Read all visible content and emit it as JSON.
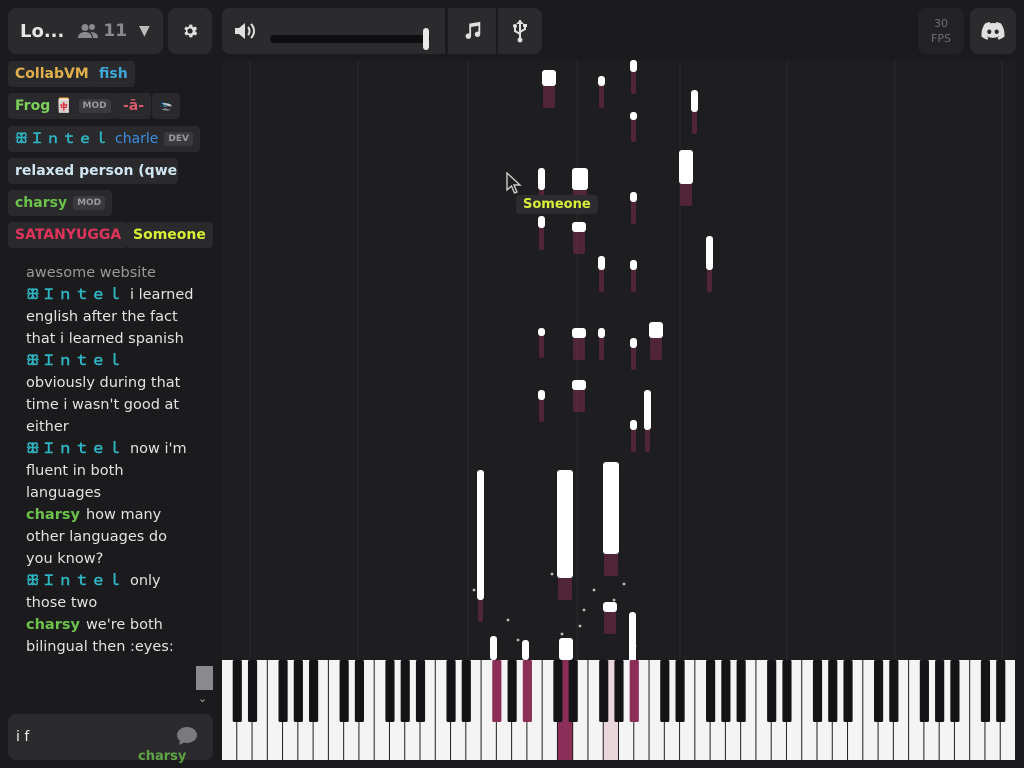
{
  "room": {
    "name": "Lo...",
    "user_count": "11"
  },
  "toolbar": {
    "volume_level": 0.96
  },
  "fps": {
    "value": "30",
    "label": "FPS"
  },
  "users": [
    {
      "name": "CollabVM",
      "color": "#e0b04a",
      "badge": ""
    },
    {
      "name": "fish",
      "color": "#3fa8d8",
      "badge": ""
    },
    {
      "name": "Frog 🀄",
      "color": "#7fd05a",
      "badge": "MOD"
    },
    {
      "name": "-ā-",
      "color": "#d85a6a",
      "badge": ""
    },
    {
      "name": "🛬",
      "color": "#dddddd",
      "badge": ""
    },
    {
      "name": "ꕥＩｎｔｅｌ",
      "color": "#2fb6c4",
      "badge": ""
    },
    {
      "name": "charle",
      "color": "#3a8ee6",
      "badge": "DEV"
    },
    {
      "name": "relaxed person (qwer...",
      "color": "#cfe6f2",
      "badge": ""
    },
    {
      "name": "charsy",
      "color": "#6cc24a",
      "badge": "MOD"
    },
    {
      "name": "SATANYUGGA",
      "color": "#e0335c",
      "badge": ""
    },
    {
      "name": "Someone",
      "color": "#d8ef34",
      "badge": ""
    }
  ],
  "chat": {
    "first_line": "awesome website",
    "messages": [
      {
        "user": "ꕥＩｎｔｅｌ",
        "color": "#2fb6c4",
        "text": "i learned english after the fact that i learned spanish"
      },
      {
        "user": "ꕥＩｎｔｅｌ",
        "color": "#2fb6c4",
        "text": "obviously during that time i wasn't good at either"
      },
      {
        "user": "ꕥＩｎｔｅｌ",
        "color": "#2fb6c4",
        "text": "now i'm fluent in both languages"
      },
      {
        "user": "charsy",
        "color": "#6cc24a",
        "text": "how many other languages do you know?"
      },
      {
        "user": "ꕥＩｎｔｅｌ",
        "color": "#2fb6c4",
        "text": "only those two"
      },
      {
        "user": "charsy",
        "color": "#6cc24a",
        "text": "we're both bilingual then :eyes:"
      }
    ],
    "input_value": "i f",
    "overlay_user": "charsy"
  },
  "cursors": [
    {
      "name": "Someone",
      "color": "#d8ef34"
    }
  ],
  "colors": {
    "note": "#ffffff",
    "active_key": "#8b2f58",
    "trail": "#7a2c4c",
    "selected_key": "#e8d6da"
  }
}
